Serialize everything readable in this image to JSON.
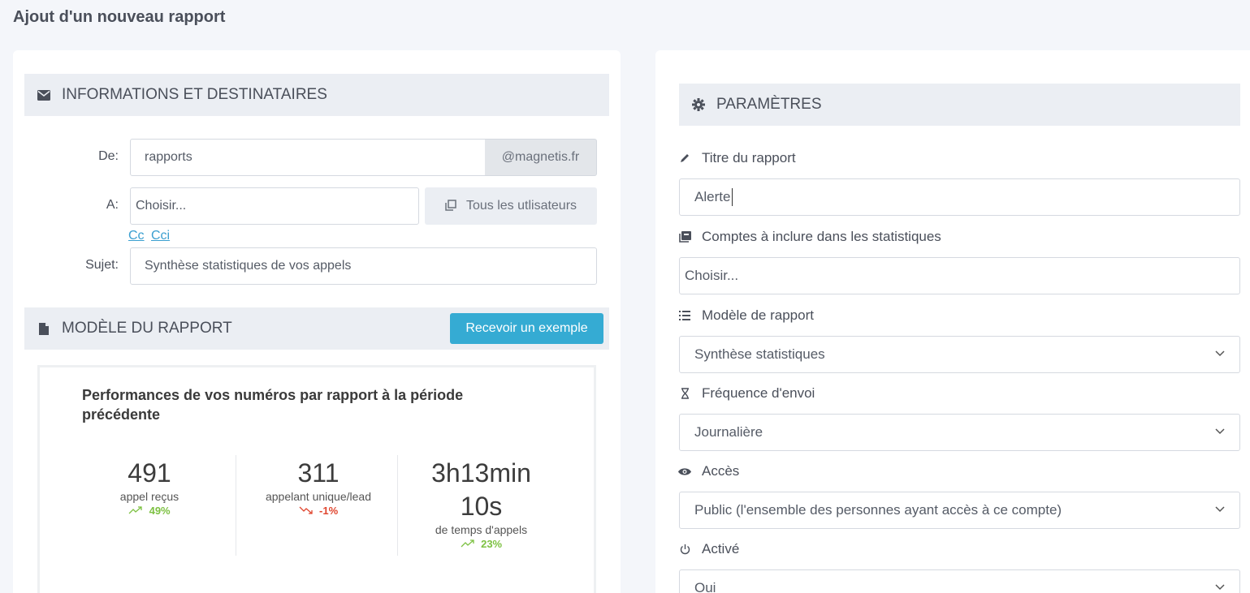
{
  "page": {
    "title": "Ajout d'un nouveau rapport"
  },
  "info": {
    "heading": "INFORMATIONS ET DESTINATAIRES",
    "from_label": "De:",
    "from_value": "rapports",
    "from_domain": "@magnetis.fr",
    "to_label": "A:",
    "to_placeholder": "Choisir...",
    "all_users_label": "Tous les utlisateurs",
    "cc_label": "Cc",
    "cci_label": "Cci",
    "subject_label": "Sujet:",
    "subject_value": "Synthèse statistiques de vos appels"
  },
  "model": {
    "heading": "MODÈLE DU RAPPORT",
    "example_button": "Recevoir un exemple",
    "preview": {
      "title": "Performances de vos numéros par rapport à la période précédente",
      "stats": [
        {
          "value": "491",
          "label": "appel reçus",
          "trend": "49%",
          "direction": "up"
        },
        {
          "value": "311",
          "label": "appelant unique/lead",
          "trend": "-1%",
          "direction": "down"
        },
        {
          "value_line1": "3h13min",
          "value_line2": "10s",
          "label": "de temps d'appels",
          "trend": "23%",
          "direction": "up"
        }
      ]
    }
  },
  "params": {
    "heading": "PARAMÈTRES",
    "title_label": "Titre du rapport",
    "title_value": "Alerte",
    "accounts_label": "Comptes à inclure dans les statistiques",
    "accounts_placeholder": "Choisir...",
    "model_label": "Modèle de rapport",
    "model_value": "Synthèse statistiques",
    "frequency_label": "Fréquence d'envoi",
    "frequency_value": "Journalière",
    "access_label": "Accès",
    "access_value": "Public (l'ensemble des personnes ayant accès à ce compte)",
    "active_label": "Activé",
    "active_value": "Oui"
  },
  "colors": {
    "accent": "#35abd3",
    "trend_up": "#7dc142",
    "trend_down": "#e0462f"
  }
}
